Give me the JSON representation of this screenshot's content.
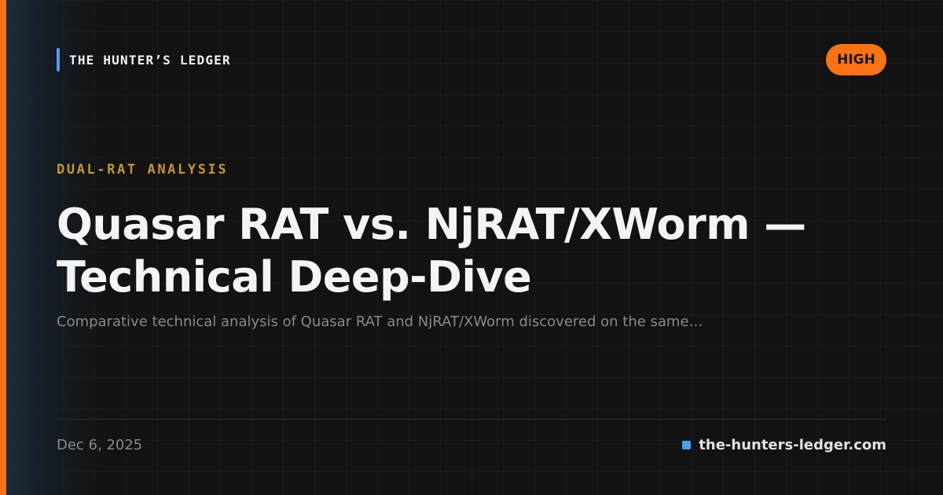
{
  "brand": {
    "name": "THE HUNTER’S LEDGER"
  },
  "severity": {
    "label": "HIGH"
  },
  "article": {
    "kicker": "DUAL-RAT ANALYSIS",
    "title": "Quasar RAT vs. NjRAT/XWorm — Technical Deep-Dive",
    "summary": "Comparative technical analysis of Quasar RAT and NjRAT/XWorm discovered on the same…",
    "date": "Dec 6, 2025"
  },
  "footer": {
    "site": "the-hunters-ledger.com"
  },
  "colors": {
    "accent_orange": "#f97316",
    "accent_blue": "#4f9cf0",
    "kicker_gold": "#c4953a",
    "background": "#121212"
  }
}
